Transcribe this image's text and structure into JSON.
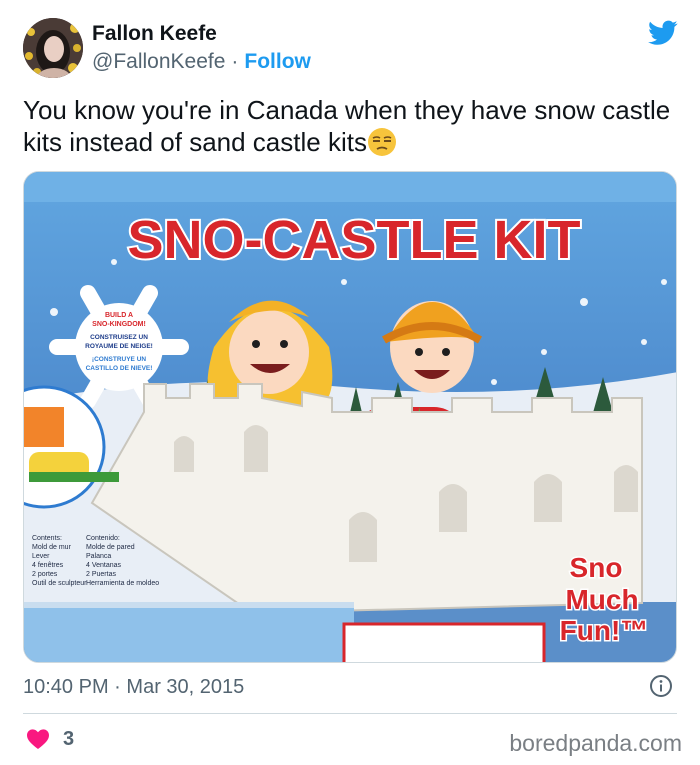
{
  "user": {
    "name": "Fallon Keefe",
    "handle": "@FallonKeefe",
    "follow_label": "Follow",
    "separator": "·"
  },
  "tweet": {
    "text": "You know you're in Canada when they have snow castle kits instead of sand castle kits",
    "emoji": "unamused-face"
  },
  "photo": {
    "box_title": "SNO-CASTLE KIT",
    "snowflake_text": [
      "BUILD A",
      "SNO-KINGDOM!",
      "CONSTRUISEZ UN",
      "ROYAUME DE NEIGE!",
      "¡CONSTRUYE UN",
      "CASTILLO DE NIEVE!"
    ],
    "slogan": [
      "Sno",
      "Much",
      "Fun!™"
    ],
    "contents": [
      "Contents:",
      "Mold de mur",
      "Lever",
      "4 fenêtres",
      "2 portes",
      "Outil de sculpteur"
    ],
    "contents_es": [
      "Contenido:",
      "Molde de pared",
      "Palanca",
      "4 Ventanas",
      "2 Puertas",
      "Herramienta de moldeo"
    ],
    "colors": {
      "sky": "#4c8cd0",
      "title_red": "#d8262b",
      "castle": "#f4f2ec"
    }
  },
  "meta": {
    "time": "10:40 PM",
    "date": "Mar 30, 2015",
    "separator": "·"
  },
  "engagement": {
    "likes": "3"
  },
  "watermark": "boredpanda.com",
  "brand": {
    "twitter_blue": "#1d9bf0"
  }
}
